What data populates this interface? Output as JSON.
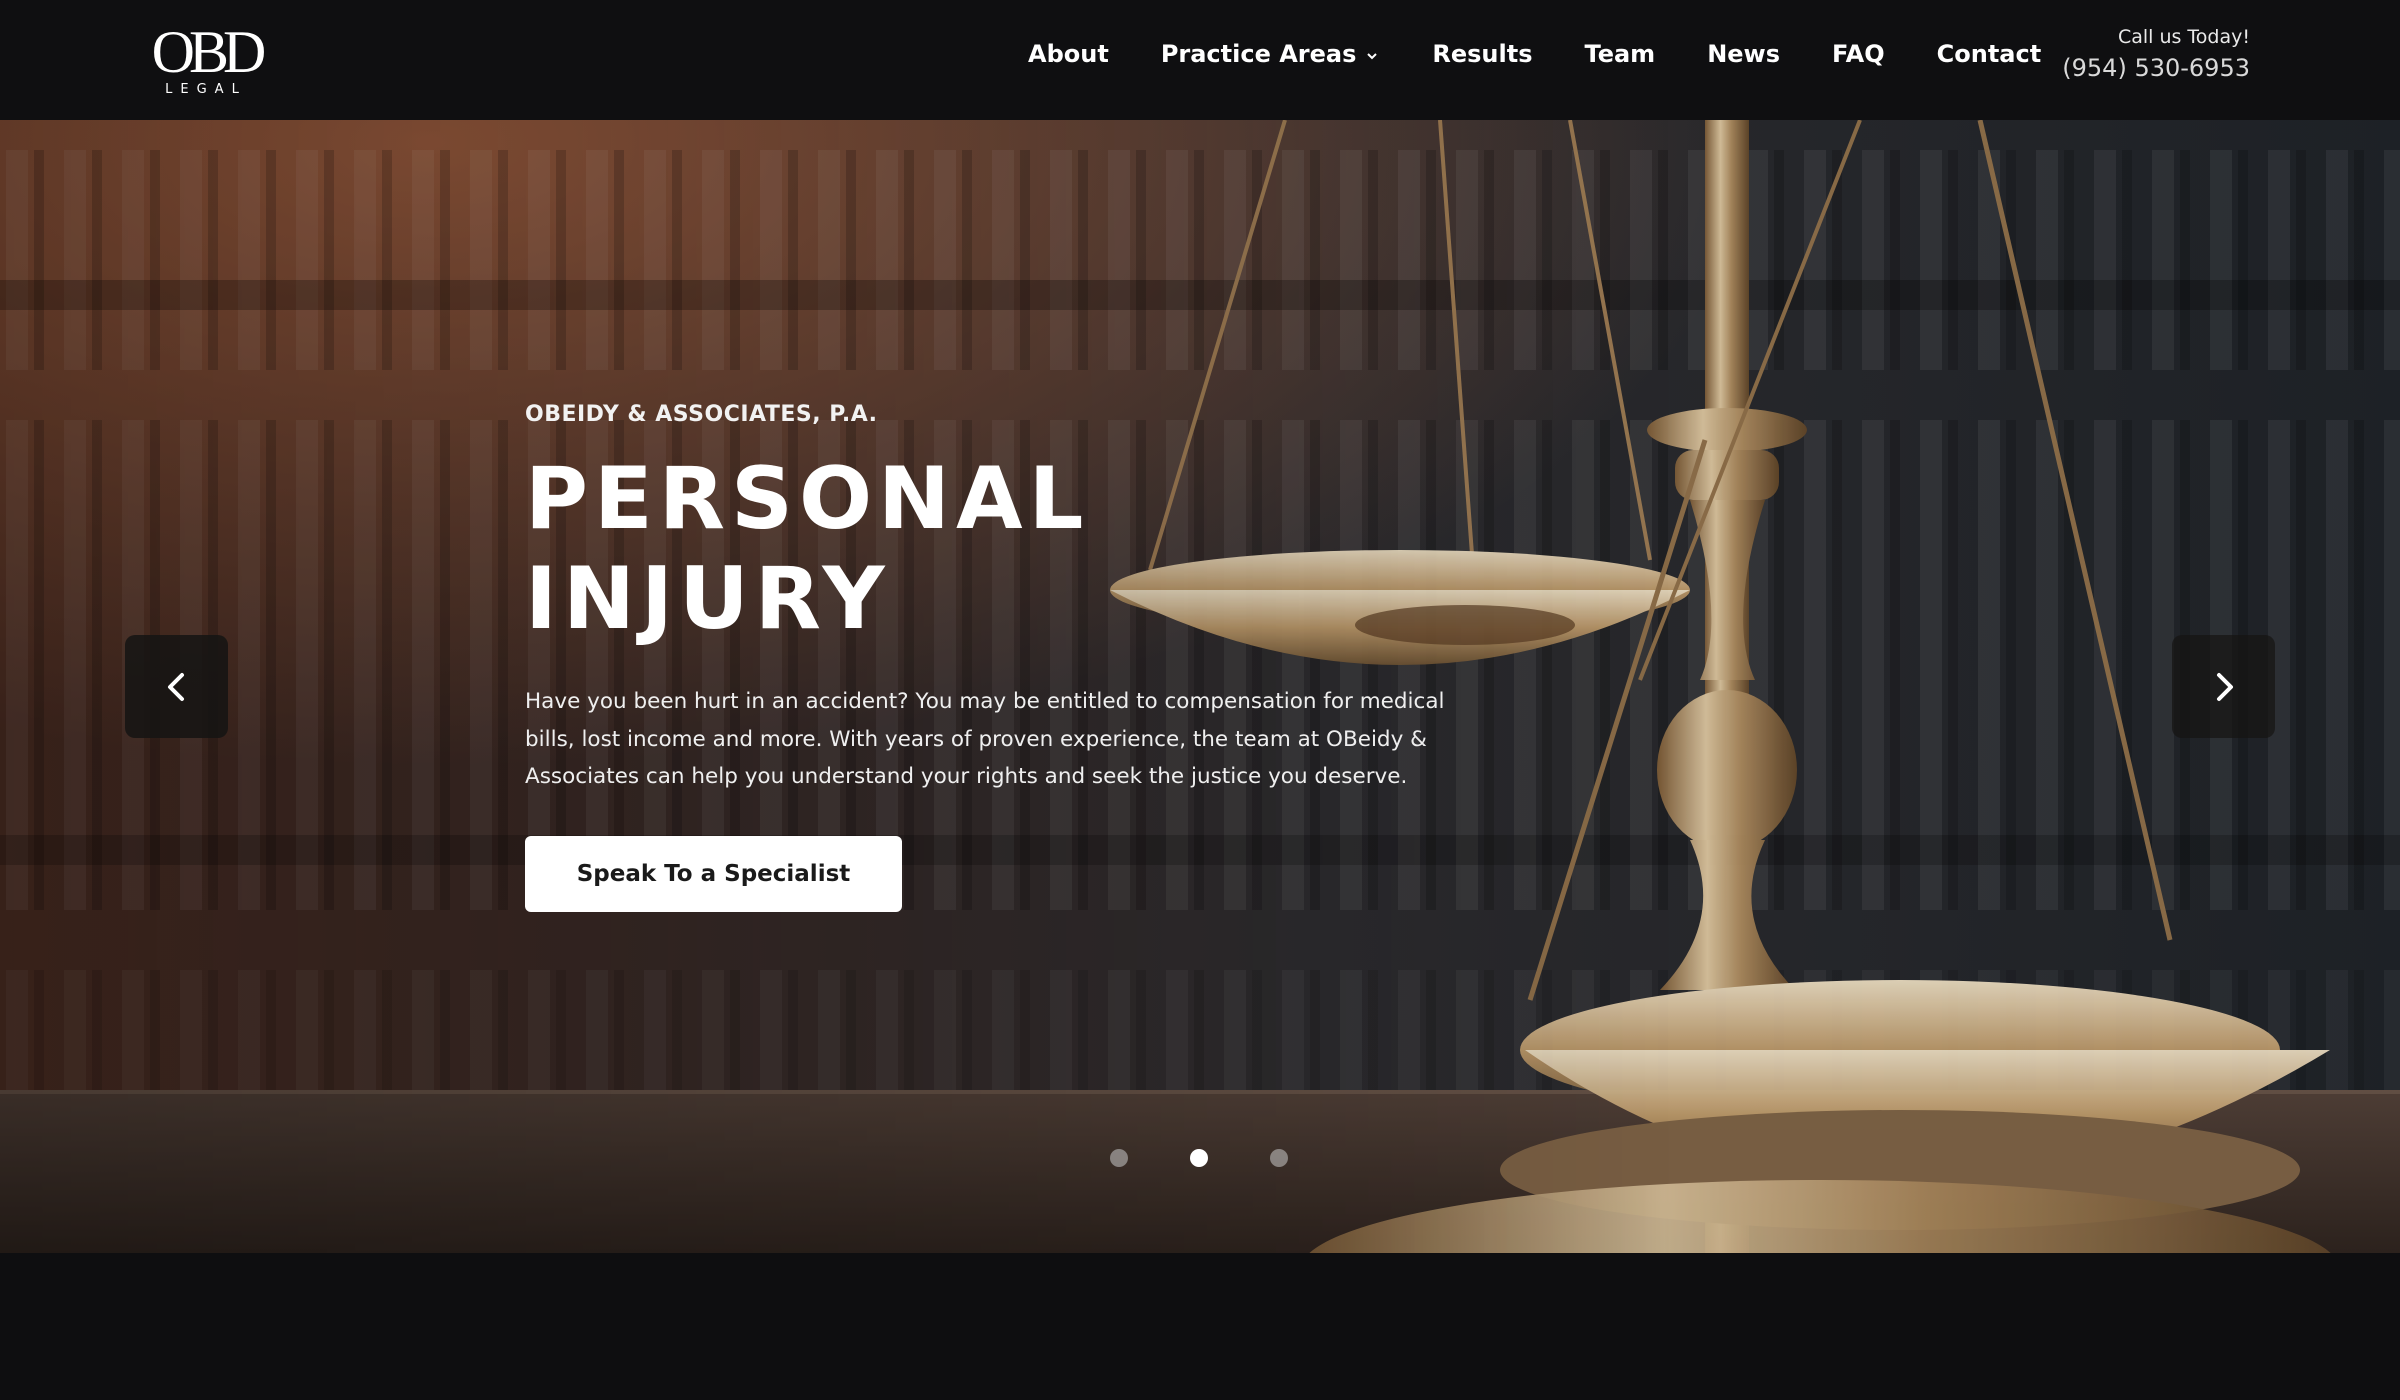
{
  "header": {
    "logo_text": "OBD",
    "logo_sub": "LEGAL",
    "nav": [
      {
        "label": "About"
      },
      {
        "label": "Practice Areas",
        "has_dropdown": true
      },
      {
        "label": "Results"
      },
      {
        "label": "Team"
      },
      {
        "label": "News"
      },
      {
        "label": "FAQ"
      },
      {
        "label": "Contact"
      }
    ],
    "call_label": "Call us Today!",
    "phone": "(954) 530-6953"
  },
  "hero": {
    "eyebrow": "OBEIDY & ASSOCIATES, P.A.",
    "headline_line1": "PERSONAL",
    "headline_line2": "INJURY",
    "description": "Have you been hurt in an accident? You may be entitled to compensation for medical bills, lost income and more. With years of proven experience, the team at OBeidy & Associates can help you understand your rights and seek the justice you deserve.",
    "cta_label": "Speak To a Specialist",
    "prev_icon": "chevron-left-icon",
    "next_icon": "chevron-right-icon",
    "slides": 3,
    "active_slide": 2
  },
  "colors": {
    "header_bg": "#0f0f11",
    "page_bg": "#0e0e10",
    "cta_bg": "#ffffff",
    "cta_text": "#1a1a1a",
    "brass": "#c9a66b"
  }
}
